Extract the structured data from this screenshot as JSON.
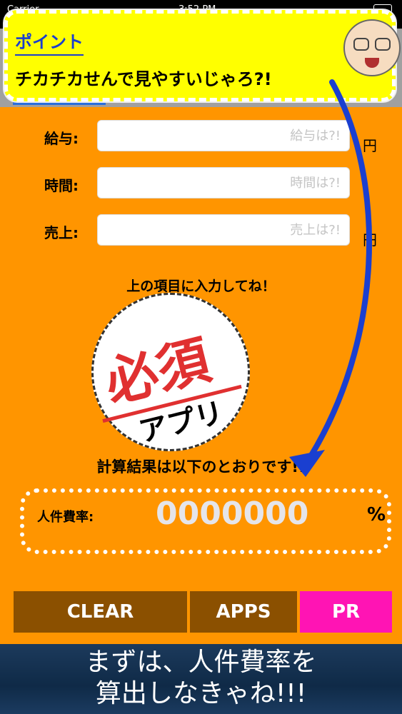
{
  "status_bar": {
    "carrier": "Carrier",
    "time": "3:52 PM"
  },
  "callout": {
    "heading": "ポイント",
    "message": "チカチカせんで見やすいじゃろ?!"
  },
  "form": {
    "rows": [
      {
        "label": "給与:",
        "placeholder": "給与は?!",
        "unit": "円"
      },
      {
        "label": "時間:",
        "placeholder": "時間は?!",
        "unit": ""
      },
      {
        "label": "売上:",
        "placeholder": "売上は?!",
        "unit": "円"
      }
    ],
    "hint": "上の項目に入力してね！"
  },
  "stamp": {
    "main": "必須",
    "sub": "アプリ"
  },
  "result": {
    "title": "計算結果は以下のとおりです!!",
    "label": "人件費率:",
    "value": "0000000",
    "unit": "%"
  },
  "buttons": {
    "clear": "CLEAR",
    "apps": "APPS",
    "pr": "PR"
  },
  "banner": {
    "line1": "まずは、人件費率を",
    "line2": "算出しなきゃね!!!"
  },
  "colors": {
    "background": "#ff9500",
    "callout": "#ffff00",
    "button_brown": "#8b5000",
    "button_pr": "#ff14b4",
    "arrow": "#1a3fd0"
  }
}
